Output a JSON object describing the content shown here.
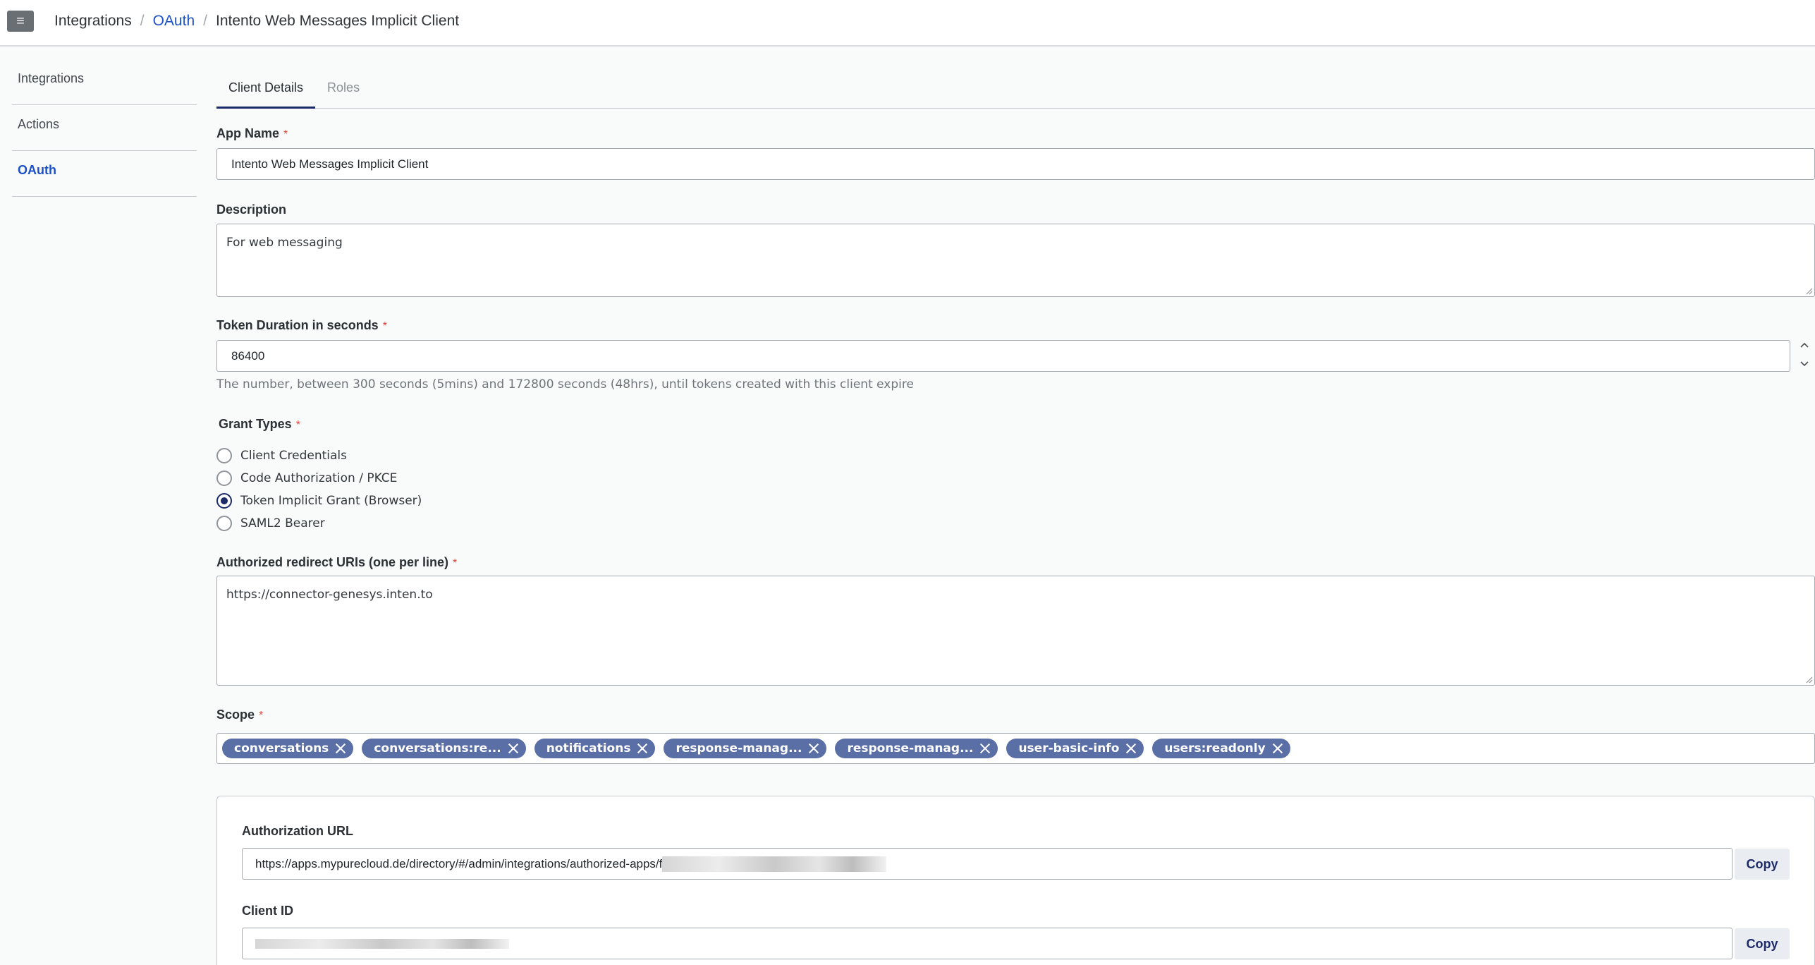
{
  "breadcrumb": {
    "root": "Integrations",
    "section": "OAuth",
    "current": "Intento Web Messages Implicit Client",
    "separator": "/"
  },
  "sidebar": {
    "items": [
      {
        "label": "Integrations",
        "active": false
      },
      {
        "label": "Actions",
        "active": false
      },
      {
        "label": "OAuth",
        "active": true
      }
    ]
  },
  "tabs": [
    {
      "label": "Client Details",
      "active": true
    },
    {
      "label": "Roles",
      "active": false
    }
  ],
  "form": {
    "app_name": {
      "label": "App Name",
      "required_mark": "*",
      "value": "Intento Web Messages Implicit Client"
    },
    "description": {
      "label": "Description",
      "value": "For web messaging"
    },
    "token_duration": {
      "label": "Token Duration in seconds",
      "required_mark": "*",
      "value": "86400",
      "help": "The number, between 300 seconds (5mins) and 172800 seconds (48hrs), until tokens created with this client expire"
    },
    "grant_types": {
      "label": "Grant Types",
      "required_mark": "*",
      "options": [
        {
          "label": "Client Credentials",
          "checked": false
        },
        {
          "label": "Code Authorization / PKCE",
          "checked": false
        },
        {
          "label": "Token Implicit Grant (Browser)",
          "checked": true
        },
        {
          "label": "SAML2 Bearer",
          "checked": false
        }
      ]
    },
    "redirect_uris": {
      "label": "Authorized redirect URIs (one per line)",
      "required_mark": "*",
      "value": "https://connector-genesys.inten.to"
    },
    "scope": {
      "label": "Scope",
      "required_mark": "*",
      "chips": [
        "conversations",
        "conversations:re...",
        "notifications",
        "response-manag...",
        "response-manag...",
        "user-basic-info",
        "users:readonly"
      ]
    }
  },
  "credentials": {
    "authorization_url": {
      "label": "Authorization URL",
      "value": "https://apps.mypurecloud.de/directory/#/admin/integrations/authorized-apps/f",
      "copy_label": "Copy"
    },
    "client_id": {
      "label": "Client ID",
      "copy_label": "Copy"
    }
  },
  "colors": {
    "link": "#1d51c7",
    "accent": "#1c2a6a",
    "chip": "#5a6fa6",
    "required": "#e8423c"
  },
  "icons": {
    "menu": "hamburger-menu-icon",
    "chip_remove": "close-icon",
    "spinner": "chevron-up-down-icon"
  }
}
